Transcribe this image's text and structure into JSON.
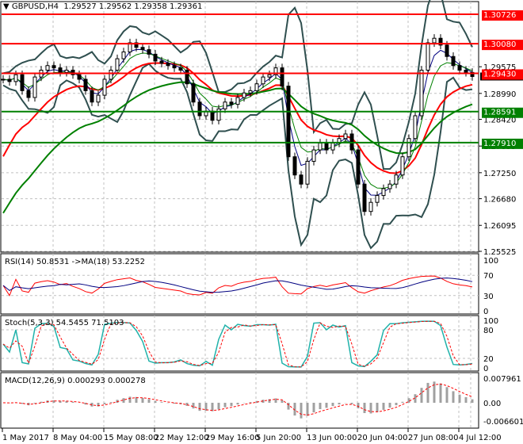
{
  "header": {
    "symbol": "GBPUSD,H4",
    "open": "1.29527",
    "high": "1.29562",
    "low": "1.29358",
    "close": "1.29361"
  },
  "indicators": {
    "rsi": "RSI(14) 50.8531  ->MA(18) 53.2252",
    "stoch": "Stoch(5,3,3) 54.5455 71.5103",
    "macd": "MACD(12,26,9) 0.000293 0.000278"
  },
  "colors": {
    "up": "#000000",
    "red": "#ff0000",
    "green": "#008000",
    "bands": "#2f4f4f",
    "signal": "#000080",
    "stoch": "#20b2aa"
  },
  "chart_data": {
    "type": "candlestick",
    "title": "GBPUSD,H4",
    "ylim": [
      1.25525,
      1.30726
    ],
    "y_ticks": [
      "1.29575",
      "1.28990",
      "1.28420",
      "1.27835",
      "1.27250",
      "1.26680",
      "1.26095",
      "1.25525"
    ],
    "x_ticks": [
      "1 May 2017",
      "8 May 04:00",
      "15 May 08:00",
      "22 May 12:00",
      "29 May 16:00",
      "5 Jun 20:00",
      "13 Jun 00:00",
      "20 Jun 04:00",
      "27 Jun 08:00",
      "4 Jul 12:00"
    ],
    "closes": [
      1.293,
      1.2925,
      1.294,
      1.2905,
      1.289,
      1.2935,
      1.295,
      1.296,
      1.2955,
      1.2945,
      1.295,
      1.294,
      1.293,
      1.2905,
      1.288,
      1.2895,
      1.293,
      1.295,
      1.2975,
      1.299,
      1.301,
      1.3,
      1.2995,
      1.2985,
      1.297,
      1.2965,
      1.296,
      1.2955,
      1.295,
      1.292,
      1.288,
      1.285,
      1.286,
      1.284,
      1.2865,
      1.288,
      1.2875,
      1.289,
      1.29,
      1.2905,
      1.292,
      1.2935,
      1.294,
      1.2955,
      1.2915,
      1.276,
      1.272,
      1.27,
      1.275,
      1.2775,
      1.279,
      1.2775,
      1.279,
      1.28,
      1.281,
      1.2775,
      1.27,
      1.264,
      1.266,
      1.2675,
      1.269,
      1.27,
      1.272,
      1.276,
      1.28,
      1.285,
      1.295,
      1.301,
      1.302,
      1.3005,
      1.298,
      1.296,
      1.295,
      1.2945,
      1.2936
    ],
    "ma_slow_red_start": 1.273,
    "ma_slow_green_start": 1.2612,
    "levels": [
      {
        "price": "1.30726",
        "color": "#ff0000"
      },
      {
        "price": "1.30080",
        "color": "#ff0000"
      },
      {
        "price": "1.29430",
        "color": "#ff0000"
      },
      {
        "price": "1.28591",
        "color": "#008000"
      },
      {
        "price": "1.27910",
        "color": "#008000"
      }
    ],
    "current_price": "1.29361",
    "rsi_scale": [
      "100",
      "70",
      "30",
      "0"
    ],
    "stoch_scale": [
      "100",
      "80",
      "20",
      "0"
    ],
    "macd_scale": [
      "0.007961",
      "0.00",
      "-0.006601"
    ]
  }
}
